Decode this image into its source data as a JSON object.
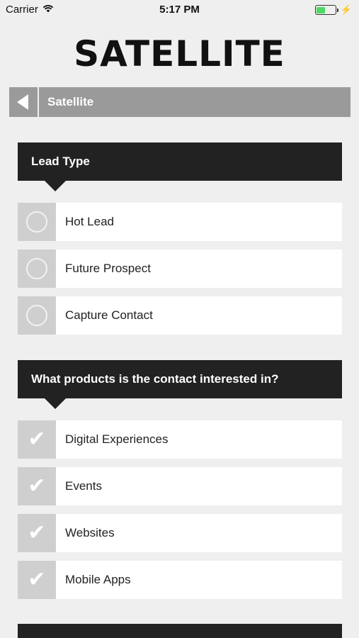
{
  "status_bar": {
    "carrier": "Carrier",
    "time": "5:17 PM",
    "battery_level": 0.45
  },
  "logo": {
    "text": "SATELLITE"
  },
  "nav": {
    "title": "Satellite"
  },
  "lead_type": {
    "header": "Lead Type",
    "options": [
      "Hot Lead",
      "Future Prospect",
      "Capture Contact"
    ]
  },
  "products": {
    "header": "What products is the contact interested in?",
    "options": [
      "Digital Experiences",
      "Events",
      "Websites",
      "Mobile Apps"
    ]
  },
  "colors": {
    "background": "#efefef",
    "header_bg": "#222222",
    "nav_bg": "#9a9a9a",
    "control_bg": "#cfcfcf"
  }
}
